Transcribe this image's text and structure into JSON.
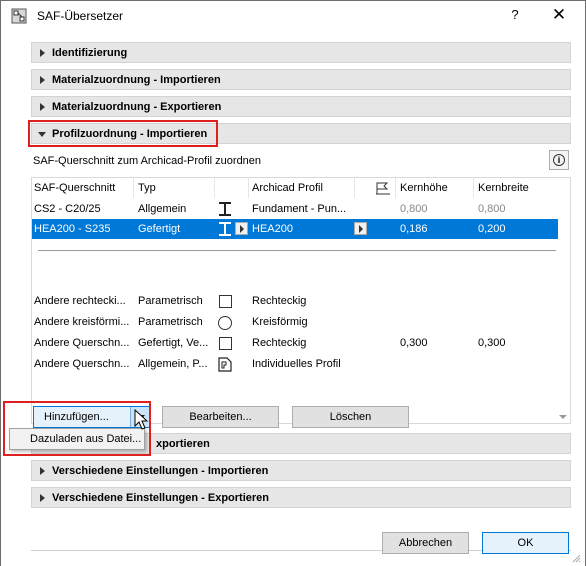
{
  "window": {
    "title": "SAF-Übersetzer",
    "help": "?",
    "close": "✕"
  },
  "sections": {
    "identifizierung": "Identifizierung",
    "material_import": "Materialzuordnung - Importieren",
    "material_export": "Materialzuordnung - Exportieren",
    "profil_import": "Profilzuordnung - Importieren",
    "profil_export_partial": "xportieren",
    "misc_import": "Verschiedene Einstellungen - Importieren",
    "misc_export": "Verschiedene Einstellungen - Exportieren"
  },
  "panel": {
    "description": "SAF-Querschnitt zum Archicad-Profil zuordnen",
    "info_icon": "i"
  },
  "table": {
    "headers": {
      "saf": "SAF-Querschnitt",
      "typ": "Typ",
      "archicad": "Archicad Profil",
      "kernhoehe": "Kernhöhe",
      "kernbreite": "Kernbreite"
    },
    "rows": [
      {
        "saf": "CS2 - C20/25",
        "typ": "Allgemein",
        "profil": "Fundament - Pun...",
        "kernhoehe": "0,800",
        "kernbreite": "0,800",
        "icon": "i-beam-icon",
        "selected": false
      },
      {
        "saf": "HEA200 - S235",
        "typ": "Gefertigt",
        "profil": "HEA200",
        "kernhoehe": "0,186",
        "kernbreite": "0,200",
        "icon": "i-beam-icon",
        "selected": true
      }
    ],
    "default_rows": [
      {
        "saf": "Andere rechtecki...",
        "typ": "Parametrisch",
        "profil": "Rechteckig",
        "kernhoehe": "",
        "kernbreite": "",
        "icon": "rectangle-icon"
      },
      {
        "saf": "Andere kreisförmi...",
        "typ": "Parametrisch",
        "profil": "Kreisförmig",
        "kernhoehe": "",
        "kernbreite": "",
        "icon": "circle-icon"
      },
      {
        "saf": "Andere Querschn...",
        "typ": "Gefertigt, Ve...",
        "profil": "Rechteckig",
        "kernhoehe": "0,300",
        "kernbreite": "0,300",
        "icon": "rectangle-icon"
      },
      {
        "saf": "Andere Querschn...",
        "typ": "Allgemein, P...",
        "profil": "Individuelles Profil",
        "kernhoehe": "",
        "kernbreite": "",
        "icon": "custom-profile-icon"
      }
    ]
  },
  "buttons": {
    "add": "Hinzufügen...",
    "edit": "Bearbeiten...",
    "delete": "Löschen",
    "cancel": "Abbrechen",
    "ok": "OK"
  },
  "dropdown": {
    "item": "Dazuladen aus Datei..."
  },
  "colors": {
    "selection": "#0078d7",
    "highlight_frame": "#e02020"
  }
}
